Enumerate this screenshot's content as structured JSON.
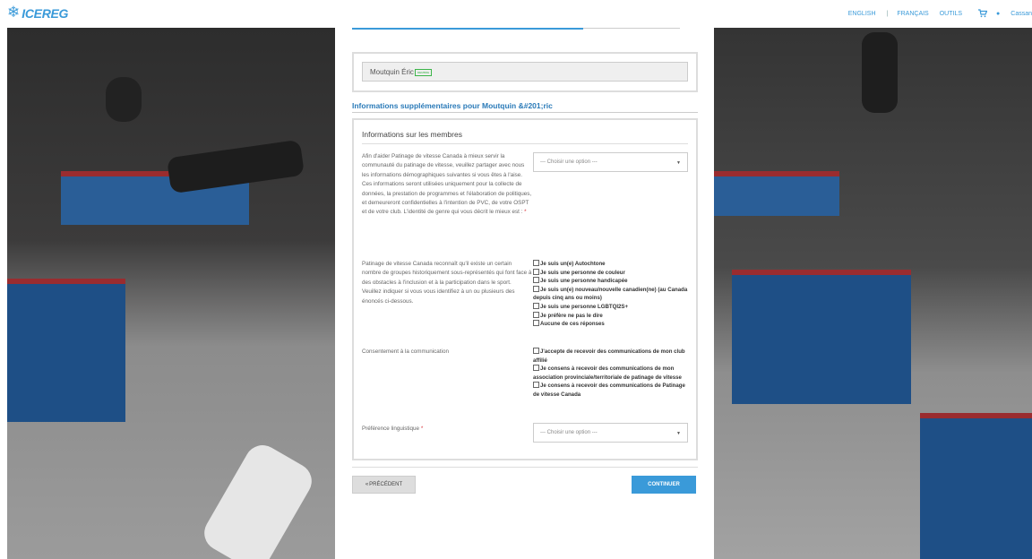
{
  "header": {
    "logo_text": "ICEREG",
    "nav": {
      "english": "ENGLISH",
      "separator": "|",
      "francais": "FRANÇAIS",
      "outils": "OUTILS",
      "user": "Cassan"
    },
    "icons": [
      "snowflake-icon",
      "cart-icon",
      "user-icon"
    ],
    "accent_color": "#3a9ad9"
  },
  "member": {
    "name": "Moutquin Éric",
    "badge": "MEMBRE"
  },
  "section": {
    "title": "Informations supplémentaires pour Moutquin &#201;ric",
    "box_title": "Informations sur les membres"
  },
  "questions": {
    "gender": {
      "text": "Afin d'aider Patinage de vitesse Canada à mieux servir la communauté du patinage de vitesse, veuillez partager avec nous les informations démographiques suivantes si vous êtes à l'aise. Ces informations seront utilisées uniquement pour la collecte de données, la prestation de programmes et l'élaboration de politiques, et demeureront confidentielles à l'intention de PVC, de votre OSPT et de votre club. L'identité de genre qui vous décrit le mieux est :",
      "required_mark": "*",
      "select_value": "--- Choisir une option ---"
    },
    "groups": {
      "text": "Patinage de vitesse Canada reconnaît qu'il existe un certain nombre de groupes historiquement sous-représentés qui font face à des obstacles à l'inclusion et à la participation dans le sport. Veuillez indiquer si vous vous identifiez à un ou plusieurs des énoncés ci-dessous.",
      "options": [
        "Je suis un(e) Autochtone",
        "Je suis une personne de couleur",
        "Je suis une personne handicapée",
        "Je suis un(e) nouveau/nouvelle canadien(ne) (au Canada depuis cinq ans ou moins)",
        "Je suis une personne LGBTQI2S+",
        "Je préfère ne pas le dire",
        "Aucune de ces réponses"
      ]
    },
    "consent": {
      "text": "Consentement à la communication",
      "options": [
        "J'accepte de recevoir des communications de mon club affilié",
        "Je consens à recevoir des communications de mon association provinciale/territoriale de patinage de vitesse",
        "Je consens à recevoir des communications de Patinage de vitesse Canada"
      ]
    },
    "language": {
      "text": "Préférence linguistique",
      "required_mark": "*",
      "select_value": "--- Choisir une option ---"
    }
  },
  "buttons": {
    "previous": "PRÉCÉDENT",
    "previous_icon": "double-chevron-left-icon",
    "continue": "CONTINUER"
  }
}
